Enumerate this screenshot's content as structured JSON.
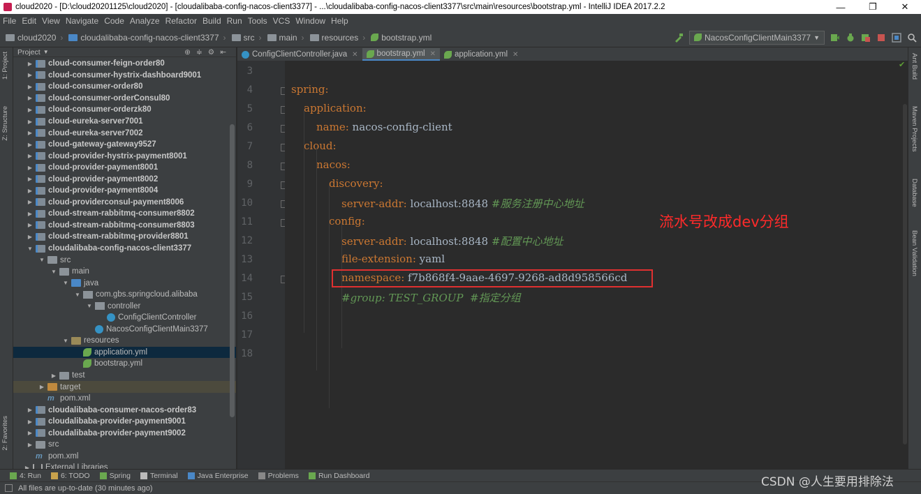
{
  "window": {
    "title": "cloud2020 - [D:\\cloud20201125\\cloud2020] - [cloudalibaba-config-nacos-client3377] - ...\\cloudalibaba-config-nacos-client3377\\src\\main\\resources\\bootstrap.yml - IntelliJ IDEA 2017.2.2",
    "minimize": "—",
    "maximize": "❐",
    "close": "✕"
  },
  "menu": [
    "File",
    "Edit",
    "View",
    "Navigate",
    "Code",
    "Analyze",
    "Refactor",
    "Build",
    "Run",
    "Tools",
    "VCS",
    "Window",
    "Help"
  ],
  "breadcrumbs": [
    "cloud2020",
    "cloudalibaba-config-nacos-client3377",
    "src",
    "main",
    "resources",
    "bootstrap.yml"
  ],
  "run_config": "NacosConfigClientMain3377",
  "left_tool_tabs": [
    "1: Project",
    "Z: Structure",
    "2: Favorites"
  ],
  "right_tool_tabs": [
    "Ant Build",
    "Maven Projects",
    "Database",
    "Bean Validation"
  ],
  "project_panel": {
    "title": "Project",
    "tree": [
      {
        "label": "cloud-consumer-feign-order80",
        "depth": 1,
        "arrow": "▶",
        "icon": "module",
        "bold": true
      },
      {
        "label": "cloud-consumer-hystrix-dashboard9001",
        "depth": 1,
        "arrow": "▶",
        "icon": "module",
        "bold": true
      },
      {
        "label": "cloud-consumer-order80",
        "depth": 1,
        "arrow": "▶",
        "icon": "module",
        "bold": true
      },
      {
        "label": "cloud-consumer-orderConsul80",
        "depth": 1,
        "arrow": "▶",
        "icon": "module",
        "bold": true
      },
      {
        "label": "cloud-consumer-orderzk80",
        "depth": 1,
        "arrow": "▶",
        "icon": "module",
        "bold": true
      },
      {
        "label": "cloud-eureka-server7001",
        "depth": 1,
        "arrow": "▶",
        "icon": "module",
        "bold": true
      },
      {
        "label": "cloud-eureka-server7002",
        "depth": 1,
        "arrow": "▶",
        "icon": "module",
        "bold": true
      },
      {
        "label": "cloud-gateway-gateway9527",
        "depth": 1,
        "arrow": "▶",
        "icon": "module",
        "bold": true
      },
      {
        "label": "cloud-provider-hystrix-payment8001",
        "depth": 1,
        "arrow": "▶",
        "icon": "module",
        "bold": true
      },
      {
        "label": "cloud-provider-payment8001",
        "depth": 1,
        "arrow": "▶",
        "icon": "module",
        "bold": true
      },
      {
        "label": "cloud-provider-payment8002",
        "depth": 1,
        "arrow": "▶",
        "icon": "module",
        "bold": true
      },
      {
        "label": "cloud-provider-payment8004",
        "depth": 1,
        "arrow": "▶",
        "icon": "module",
        "bold": true
      },
      {
        "label": "cloud-providerconsul-payment8006",
        "depth": 1,
        "arrow": "▶",
        "icon": "module",
        "bold": true
      },
      {
        "label": "cloud-stream-rabbitmq-consumer8802",
        "depth": 1,
        "arrow": "▶",
        "icon": "module",
        "bold": true
      },
      {
        "label": "cloud-stream-rabbitmq-consumer8803",
        "depth": 1,
        "arrow": "▶",
        "icon": "module",
        "bold": true
      },
      {
        "label": "cloud-stream-rabbitmq-provider8801",
        "depth": 1,
        "arrow": "▶",
        "icon": "module",
        "bold": true
      },
      {
        "label": "cloudalibaba-config-nacos-client3377",
        "depth": 1,
        "arrow": "▼",
        "icon": "module",
        "bold": true
      },
      {
        "label": "src",
        "depth": 2,
        "arrow": "▼",
        "icon": "folder",
        "bold": false
      },
      {
        "label": "main",
        "depth": 3,
        "arrow": "▼",
        "icon": "folder",
        "bold": false
      },
      {
        "label": "java",
        "depth": 4,
        "arrow": "▼",
        "icon": "src",
        "bold": false
      },
      {
        "label": "com.gbs.springcloud.alibaba",
        "depth": 5,
        "arrow": "▼",
        "icon": "pkg",
        "bold": false
      },
      {
        "label": "controller",
        "depth": 6,
        "arrow": "▼",
        "icon": "pkg",
        "bold": false
      },
      {
        "label": "ConfigClientController",
        "depth": 7,
        "arrow": "",
        "icon": "class",
        "bold": false
      },
      {
        "label": "NacosConfigClientMain3377",
        "depth": 6,
        "arrow": "",
        "icon": "class",
        "bold": false
      },
      {
        "label": "resources",
        "depth": 4,
        "arrow": "▼",
        "icon": "res",
        "bold": false
      },
      {
        "label": "application.yml",
        "depth": 5,
        "arrow": "",
        "icon": "spring",
        "bold": false,
        "selected": true
      },
      {
        "label": "bootstrap.yml",
        "depth": 5,
        "arrow": "",
        "icon": "spring",
        "bold": false
      },
      {
        "label": "test",
        "depth": 3,
        "arrow": "▶",
        "icon": "folder",
        "bold": false
      },
      {
        "label": "target",
        "depth": 2,
        "arrow": "▶",
        "icon": "target",
        "bold": false,
        "highlight": true
      },
      {
        "label": "pom.xml",
        "depth": 2,
        "arrow": "",
        "icon": "maven",
        "bold": false
      },
      {
        "label": "cloudalibaba-consumer-nacos-order83",
        "depth": 1,
        "arrow": "▶",
        "icon": "module",
        "bold": true
      },
      {
        "label": "cloudalibaba-provider-payment9001",
        "depth": 1,
        "arrow": "▶",
        "icon": "module",
        "bold": true
      },
      {
        "label": "cloudalibaba-provider-payment9002",
        "depth": 1,
        "arrow": "▶",
        "icon": "module",
        "bold": true
      },
      {
        "label": "src",
        "depth": 1,
        "arrow": "▶",
        "icon": "folder",
        "bold": false
      },
      {
        "label": "pom.xml",
        "depth": 1,
        "arrow": "",
        "icon": "maven",
        "bold": false
      },
      {
        "label": "External Libraries",
        "depth": 0,
        "arrow": "▶",
        "icon": "lib",
        "bold": false
      }
    ]
  },
  "editor_tabs": [
    {
      "label": "ConfigClientController.java",
      "icon": "class",
      "active": false
    },
    {
      "label": "bootstrap.yml",
      "icon": "spring",
      "active": true
    },
    {
      "label": "application.yml",
      "icon": "spring",
      "active": false
    }
  ],
  "code_lines": [
    {
      "num": "3",
      "indent": 0,
      "key": "",
      "value": "",
      "comment": ""
    },
    {
      "num": "4",
      "indent": 0,
      "key": "spring:",
      "value": "",
      "comment": "",
      "fold": true
    },
    {
      "num": "5",
      "indent": 1,
      "key": "application:",
      "value": "",
      "comment": "",
      "fold": true
    },
    {
      "num": "6",
      "indent": 2,
      "key": "name:",
      "value": " nacos-config-client",
      "comment": "",
      "fold": true
    },
    {
      "num": "7",
      "indent": 1,
      "key": "cloud:",
      "value": "",
      "comment": "",
      "fold": true
    },
    {
      "num": "8",
      "indent": 2,
      "key": "nacos:",
      "value": "",
      "comment": "",
      "fold": true
    },
    {
      "num": "9",
      "indent": 3,
      "key": "discovery:",
      "value": "",
      "comment": "",
      "fold": true
    },
    {
      "num": "10",
      "indent": 4,
      "key": "server-addr:",
      "value": " localhost:8848 ",
      "comment": "#服务注册中心地址",
      "fold": true
    },
    {
      "num": "11",
      "indent": 3,
      "key": "config:",
      "value": "",
      "comment": "",
      "fold": true
    },
    {
      "num": "12",
      "indent": 4,
      "key": "server-addr:",
      "value": " localhost:8848 ",
      "comment": "#配置中心地址",
      "fold": false
    },
    {
      "num": "13",
      "indent": 4,
      "key": "file-extension:",
      "value": " yaml",
      "comment": "",
      "fold": false
    },
    {
      "num": "14",
      "indent": 4,
      "key": "namespace:",
      "value": " f7b868f4-9aae-4697-9268-ad8d958566cd",
      "comment": "",
      "fold": true
    },
    {
      "num": "15",
      "indent": 4,
      "key": "",
      "value": "",
      "comment": "#group: TEST_GROUP  #指定分组",
      "fold": false
    },
    {
      "num": "16",
      "indent": 0,
      "key": "",
      "value": "",
      "comment": ""
    },
    {
      "num": "17",
      "indent": 0,
      "key": "",
      "value": "",
      "comment": ""
    },
    {
      "num": "18",
      "indent": 0,
      "key": "",
      "value": "",
      "comment": ""
    }
  ],
  "annotation": "流水号改成dev分组",
  "bottom_tools": [
    "4: Run",
    "6: TODO",
    "Spring",
    "Terminal",
    "Java Enterprise",
    "Problems",
    "Run Dashboard"
  ],
  "status": "All files are up-to-date (30 minutes ago)",
  "watermark": "CSDN @人生要用排除法",
  "colors": {
    "keyword": "#cc7832",
    "comment": "#629755",
    "annotation": "#ff2a2a",
    "box": "#e03030"
  }
}
